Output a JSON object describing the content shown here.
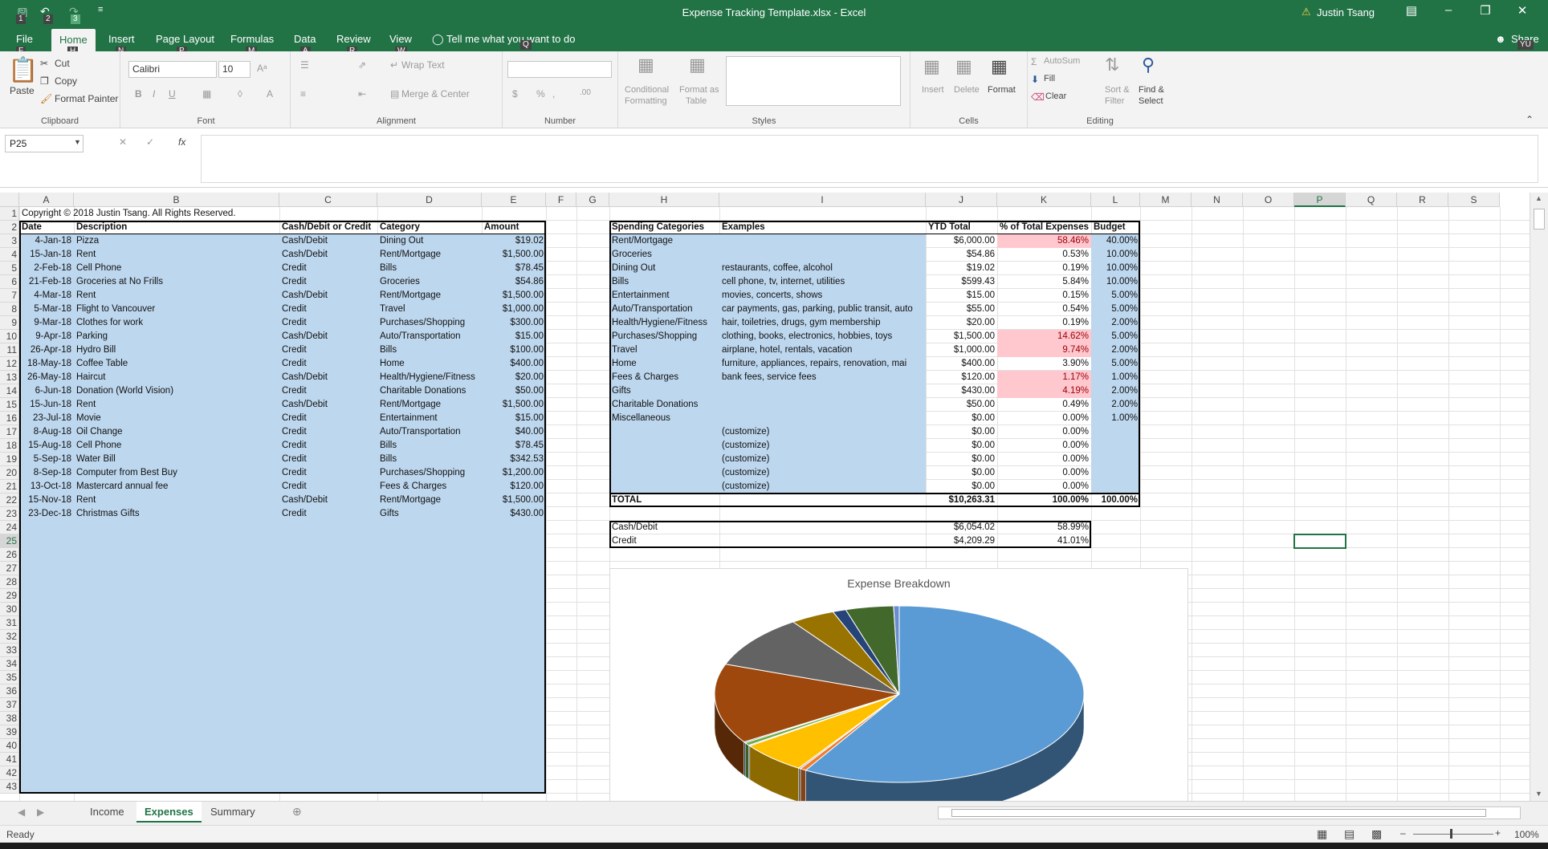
{
  "window": {
    "title": "Expense Tracking Template.xlsx  -  Excel",
    "user": "Justin Tsang",
    "share": "Share"
  },
  "keytips": {
    "qa1": "1",
    "qa2": "2",
    "qa3": "3",
    "file": "F",
    "home": "H",
    "insert": "N",
    "page": "P",
    "formulas": "M",
    "data": "A",
    "review": "R",
    "view": "W",
    "tell": "Q",
    "share": "YU"
  },
  "ribbon_tabs": [
    "File",
    "Home",
    "Insert",
    "Page Layout",
    "Formulas",
    "Data",
    "Review",
    "View"
  ],
  "tell_me": "Tell me what you want to do",
  "ribbon": {
    "clipboard": {
      "label": "Clipboard",
      "paste": "Paste",
      "cut": "Cut",
      "copy": "Copy",
      "format_painter": "Format Painter"
    },
    "font": {
      "label": "Font",
      "name": "Calibri",
      "size": "10"
    },
    "alignment": {
      "label": "Alignment",
      "wrap": "Wrap Text",
      "merge": "Merge & Center"
    },
    "number": {
      "label": "Number"
    },
    "styles": {
      "label": "Styles",
      "conditional": "Conditional",
      "formatting": "Formatting",
      "format_as": "Format as",
      "table": "Table"
    },
    "cells": {
      "label": "Cells",
      "insert": "Insert",
      "delete": "Delete",
      "format": "Format"
    },
    "editing": {
      "label": "Editing",
      "autosum": "AutoSum",
      "fill": "Fill",
      "clear": "Clear",
      "sort": "Sort &",
      "filter": "Filter",
      "find": "Find &",
      "select": "Select"
    }
  },
  "namebox": "P25",
  "columns": [
    "A",
    "B",
    "C",
    "D",
    "E",
    "F",
    "G",
    "H",
    "I",
    "J",
    "K",
    "L",
    "M",
    "N",
    "O",
    "P",
    "Q",
    "R",
    "S"
  ],
  "rows": [
    "1",
    "2",
    "3",
    "4",
    "5",
    "6",
    "7",
    "8",
    "9",
    "10",
    "11",
    "12",
    "13",
    "14",
    "15",
    "16",
    "17",
    "18",
    "19",
    "20",
    "21",
    "22",
    "23",
    "24",
    "25",
    "26",
    "27",
    "28",
    "29",
    "30",
    "31",
    "32",
    "33",
    "34",
    "35",
    "36",
    "37",
    "38",
    "39",
    "40",
    "41",
    "42",
    "43"
  ],
  "copyright": "Copyright © 2018 Justin Tsang. All Rights Reserved.",
  "expense_headers": [
    "Date",
    "Description",
    "Cash/Debit or Credit",
    "Category",
    "Amount"
  ],
  "expenses": [
    [
      "4-Jan-18",
      "Pizza",
      "Cash/Debit",
      "Dining Out",
      "$19.02"
    ],
    [
      "15-Jan-18",
      "Rent",
      "Cash/Debit",
      "Rent/Mortgage",
      "$1,500.00"
    ],
    [
      "2-Feb-18",
      "Cell Phone",
      "Credit",
      "Bills",
      "$78.45"
    ],
    [
      "21-Feb-18",
      "Groceries at No Frills",
      "Credit",
      "Groceries",
      "$54.86"
    ],
    [
      "4-Mar-18",
      "Rent",
      "Cash/Debit",
      "Rent/Mortgage",
      "$1,500.00"
    ],
    [
      "5-Mar-18",
      "Flight to Vancouver",
      "Credit",
      "Travel",
      "$1,000.00"
    ],
    [
      "9-Mar-18",
      "Clothes for work",
      "Credit",
      "Purchases/Shopping",
      "$300.00"
    ],
    [
      "9-Apr-18",
      "Parking",
      "Cash/Debit",
      "Auto/Transportation",
      "$15.00"
    ],
    [
      "26-Apr-18",
      "Hydro Bill",
      "Credit",
      "Bills",
      "$100.00"
    ],
    [
      "18-May-18",
      "Coffee Table",
      "Credit",
      "Home",
      "$400.00"
    ],
    [
      "26-May-18",
      "Haircut",
      "Cash/Debit",
      "Health/Hygiene/Fitness",
      "$20.00"
    ],
    [
      "6-Jun-18",
      "Donation (World Vision)",
      "Credit",
      "Charitable Donations",
      "$50.00"
    ],
    [
      "15-Jun-18",
      "Rent",
      "Cash/Debit",
      "Rent/Mortgage",
      "$1,500.00"
    ],
    [
      "23-Jul-18",
      "Movie",
      "Credit",
      "Entertainment",
      "$15.00"
    ],
    [
      "8-Aug-18",
      "Oil Change",
      "Credit",
      "Auto/Transportation",
      "$40.00"
    ],
    [
      "15-Aug-18",
      "Cell Phone",
      "Credit",
      "Bills",
      "$78.45"
    ],
    [
      "5-Sep-18",
      "Water Bill",
      "Credit",
      "Bills",
      "$342.53"
    ],
    [
      "8-Sep-18",
      "Computer from Best Buy",
      "Credit",
      "Purchases/Shopping",
      "$1,200.00"
    ],
    [
      "13-Oct-18",
      "Mastercard annual fee",
      "Credit",
      "Fees & Charges",
      "$120.00"
    ],
    [
      "15-Nov-18",
      "Rent",
      "Cash/Debit",
      "Rent/Mortgage",
      "$1,500.00"
    ],
    [
      "23-Dec-18",
      "Christmas Gifts",
      "Credit",
      "Gifts",
      "$430.00"
    ]
  ],
  "summary_headers": [
    "Spending Categories",
    "Examples",
    "YTD Total",
    "% of Total Expenses",
    "Budget"
  ],
  "summary": [
    [
      "Rent/Mortgage",
      "",
      "$6,000.00",
      "58.46%",
      "40.00%",
      true
    ],
    [
      "Groceries",
      "",
      "$54.86",
      "0.53%",
      "10.00%",
      false
    ],
    [
      "Dining Out",
      "restaurants, coffee, alcohol",
      "$19.02",
      "0.19%",
      "10.00%",
      false
    ],
    [
      "Bills",
      "cell phone, tv, internet, utilities",
      "$599.43",
      "5.84%",
      "10.00%",
      false
    ],
    [
      "Entertainment",
      "movies, concerts, shows",
      "$15.00",
      "0.15%",
      "5.00%",
      false
    ],
    [
      "Auto/Transportation",
      "car payments, gas, parking, public transit, auto",
      "$55.00",
      "0.54%",
      "5.00%",
      false
    ],
    [
      "Health/Hygiene/Fitness",
      "hair, toiletries, drugs, gym membership",
      "$20.00",
      "0.19%",
      "2.00%",
      false
    ],
    [
      "Purchases/Shopping",
      "clothing, books, electronics, hobbies, toys",
      "$1,500.00",
      "14.62%",
      "5.00%",
      true
    ],
    [
      "Travel",
      "airplane, hotel, rentals, vacation",
      "$1,000.00",
      "9.74%",
      "2.00%",
      true
    ],
    [
      "Home",
      "furniture, appliances, repairs, renovation, mai",
      "$400.00",
      "3.90%",
      "5.00%",
      false
    ],
    [
      "Fees & Charges",
      "bank fees, service fees",
      "$120.00",
      "1.17%",
      "1.00%",
      true
    ],
    [
      "Gifts",
      "",
      "$430.00",
      "4.19%",
      "2.00%",
      true
    ],
    [
      "Charitable Donations",
      "",
      "$50.00",
      "0.49%",
      "2.00%",
      false
    ],
    [
      "Miscellaneous",
      "",
      "$0.00",
      "0.00%",
      "1.00%",
      false
    ],
    [
      "",
      "(customize)",
      "$0.00",
      "0.00%",
      "",
      false
    ],
    [
      "",
      "(customize)",
      "$0.00",
      "0.00%",
      "",
      false
    ],
    [
      "",
      "(customize)",
      "$0.00",
      "0.00%",
      "",
      false
    ],
    [
      "",
      "(customize)",
      "$0.00",
      "0.00%",
      "",
      false
    ],
    [
      "",
      "(customize)",
      "$0.00",
      "0.00%",
      "",
      false
    ]
  ],
  "total": {
    "label": "TOTAL",
    "ytd": "$10,263.31",
    "pct": "100.00%",
    "budget": "100.00%"
  },
  "payment": [
    [
      "Cash/Debit",
      "$6,054.02",
      "58.99%"
    ],
    [
      "Credit",
      "$4,209.29",
      "41.01%"
    ]
  ],
  "chart_data": {
    "type": "pie",
    "title": "Expense Breakdown",
    "categories": [
      "Rent/Mortgage",
      "Groceries",
      "Dining Out",
      "Bills",
      "Entertainment",
      "Auto/Transportation",
      "Health/Hygiene/Fitness",
      "Purchases/Shopping",
      "Travel",
      "Home",
      "Fees & Charges",
      "Gifts",
      "Charitable Donations",
      "Miscellaneous"
    ],
    "values": [
      58.46,
      0.53,
      0.19,
      5.84,
      0.15,
      0.54,
      0.19,
      14.62,
      9.74,
      3.9,
      1.17,
      4.19,
      0.49,
      0.0
    ],
    "colors": [
      "#5b9bd5",
      "#ed7d31",
      "#a5a5a5",
      "#ffc000",
      "#4472c4",
      "#70ad47",
      "#255e91",
      "#9e480e",
      "#636363",
      "#997300",
      "#264478",
      "#43682b",
      "#698ed0",
      "#f1975a"
    ]
  },
  "sheet_tabs": [
    "Income",
    "Expenses",
    "Summary"
  ],
  "status": {
    "ready": "Ready",
    "zoom": "100%"
  }
}
